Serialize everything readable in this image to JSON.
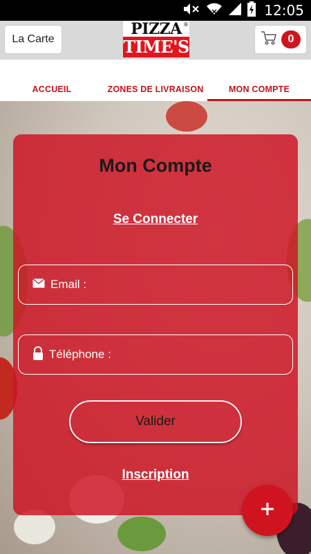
{
  "status_bar": {
    "time": "12:05",
    "icons": [
      "mute-icon",
      "wifi-icon",
      "signal-icon",
      "battery-charging-icon"
    ]
  },
  "header": {
    "menu_button_label": "La Carte",
    "logo_top": "PIZZA",
    "logo_bottom": "TIME'S",
    "logo_registered": "®",
    "cart_icon": "cart-icon",
    "cart_count": "0"
  },
  "tabs": [
    {
      "label": "ACCUEIL",
      "active": false
    },
    {
      "label": "ZONES DE LIVRAISON",
      "active": false
    },
    {
      "label": "MON COMPTE",
      "active": true
    }
  ],
  "account": {
    "title": "Mon Compte",
    "connect_link": "Se Connecter",
    "email_label": "Email :",
    "email_icon": "envelope-icon",
    "phone_label": "Téléphone :",
    "phone_icon": "lock-icon",
    "submit_label": "Valider",
    "signup_link": "Inscription"
  },
  "fab": {
    "icon": "plus-icon"
  },
  "colors": {
    "brand_red": "#d0141f",
    "tab_red": "#c0141c",
    "card_bg": "rgba(205,20,36,0.84)",
    "header_bg": "#d9d9d9"
  }
}
